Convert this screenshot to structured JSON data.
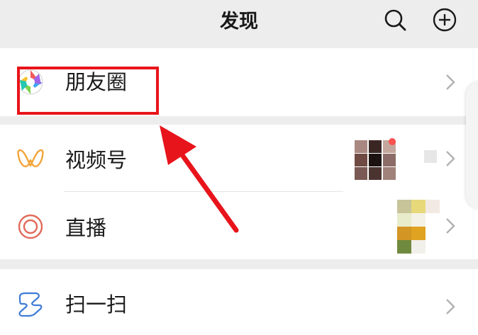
{
  "header": {
    "title": "发现",
    "search_icon": "search-icon",
    "add_icon": "plus-circle-icon"
  },
  "menu": {
    "moments": {
      "label": "朋友圈",
      "icon": "moments-aperture-icon"
    },
    "channels": {
      "label": "视频号",
      "icon": "channels-icon"
    },
    "live": {
      "label": "直播",
      "icon": "live-icon"
    },
    "scan": {
      "label": "扫一扫",
      "icon": "scan-icon"
    }
  },
  "colors": {
    "background": "#ededed",
    "surface": "#ffffff",
    "text": "#191919",
    "annotation_red": "#e8141b",
    "channels_orange": "#f3a53b",
    "live_red": "#e16a5a",
    "scan_blue": "#3d7bd6",
    "badge_red": "#fa5151"
  }
}
